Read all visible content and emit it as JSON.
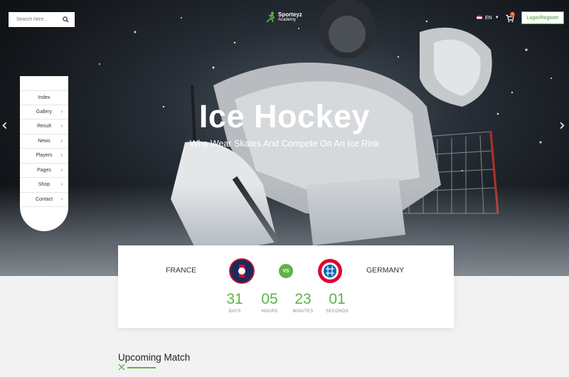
{
  "header": {
    "search_placeholder": "Search here...",
    "brand_name": "Sporteyz",
    "brand_sub": "Academy",
    "language": "EN",
    "cart_count": "0",
    "login_label": "Login/Register"
  },
  "side_menu": {
    "items": [
      {
        "label": "Index"
      },
      {
        "label": "Gallery"
      },
      {
        "label": "Result"
      },
      {
        "label": "News"
      },
      {
        "label": "Players"
      },
      {
        "label": "Pages"
      },
      {
        "label": "Shop"
      },
      {
        "label": "Contact"
      }
    ]
  },
  "hero": {
    "title": "Ice Hockey",
    "subtitle": "Who Wear Skates And Compete On An Ice Rink",
    "prev_arrow": "‹",
    "next_arrow": "›"
  },
  "match": {
    "home_team": "FRANCE",
    "away_team": "GERMANY",
    "vs_label": "VS",
    "countdown": {
      "days": "31",
      "days_label": "DAYS",
      "hours": "05",
      "hours_label": "HOURS",
      "minutes": "23",
      "minutes_label": "MINUTES",
      "seconds": "01",
      "seconds_label": "SECONDS"
    }
  },
  "section": {
    "upcoming_title": "Upcoming Match"
  },
  "colors": {
    "accent": "#5fb246",
    "hero_bg": "#111418"
  }
}
